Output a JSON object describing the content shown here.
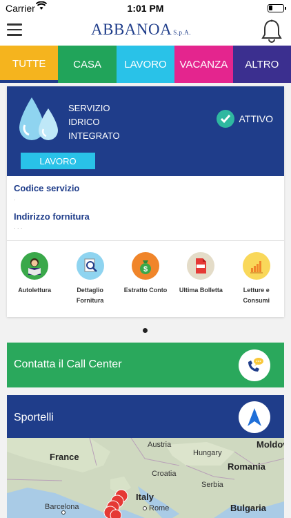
{
  "status_bar": {
    "carrier": "Carrier",
    "time": "1:01 PM"
  },
  "header": {
    "logo": "ABBANOA",
    "logo_suffix": "S.p.A."
  },
  "tabs": [
    {
      "label": "TUTTE",
      "color": "#f5b41e"
    },
    {
      "label": "CASA",
      "color": "#21a45a"
    },
    {
      "label": "LAVORO",
      "color": "#29c2e8"
    },
    {
      "label": "VACANZA",
      "color": "#e4258e"
    },
    {
      "label": "ALTRO",
      "color": "#3b2f8f"
    }
  ],
  "service": {
    "name_lines": [
      "SERVIZIO",
      "IDRICO",
      "INTEGRATO"
    ],
    "status": "ATTIVO",
    "category": "LAVORO",
    "codice_label": "Codice servizio",
    "codice_value": "·",
    "indirizzo_label": "Indirizzo fornitura",
    "indirizzo_value": "· · ·"
  },
  "actions": [
    {
      "label": "Autolettura",
      "icon": "reader-icon"
    },
    {
      "label": "Dettaglio Fornitura",
      "icon": "magnifier-document-icon"
    },
    {
      "label": "Estratto Conto",
      "icon": "money-bag-icon"
    },
    {
      "label": "Ultima Bolletta",
      "icon": "pdf-icon"
    },
    {
      "label": "Letture e Consumi",
      "icon": "bar-chart-icon"
    }
  ],
  "call_center": {
    "label": "Contatta il Call Center"
  },
  "sportelli": {
    "label": "Sportelli"
  },
  "map": {
    "labels": [
      "Austria",
      "Moldov",
      "France",
      "Hungary",
      "Romania",
      "Croatia",
      "Serbia",
      "Italy",
      "Barcelona",
      "Rome",
      "Bulgaria"
    ]
  }
}
